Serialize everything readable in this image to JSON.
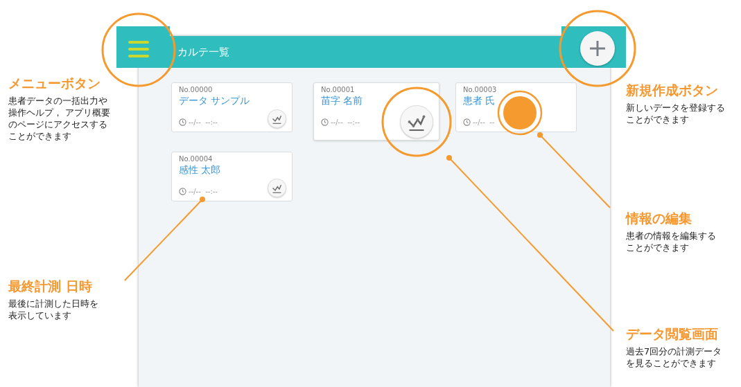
{
  "app": {
    "title": "カルテ一覧"
  },
  "cards": [
    {
      "number": "No.00000",
      "name": "データ サンプル",
      "time": "--/--  --:--",
      "kind": "normal"
    },
    {
      "number": "No.00001",
      "name": "苗字 名前",
      "time": "--/--  --:--",
      "kind": "spotlit"
    },
    {
      "number": "No.00003",
      "name": "患者 氏",
      "time": "--/--  --",
      "kind": "covered"
    },
    {
      "number": "No.00004",
      "name": "感性 太郎",
      "time": "--/--  --:--",
      "kind": "normal"
    }
  ],
  "annotations": [
    {
      "title": "メニューボタン",
      "text": "患者データの一括出力や操作ヘルプ， アプリ概要のページにアクセスすることができます"
    },
    {
      "title": "新規作成ボタン",
      "text": "新しいデータを登録することができます"
    },
    {
      "title": "情報の編集",
      "text": "患者の情報を編集することができます"
    },
    {
      "title": "最終計測 日時",
      "text": "最後に計測した日時を表示しています"
    },
    {
      "title": "データ閲覧画面",
      "text": "過去7回分の計測データを見ることができます"
    }
  ]
}
